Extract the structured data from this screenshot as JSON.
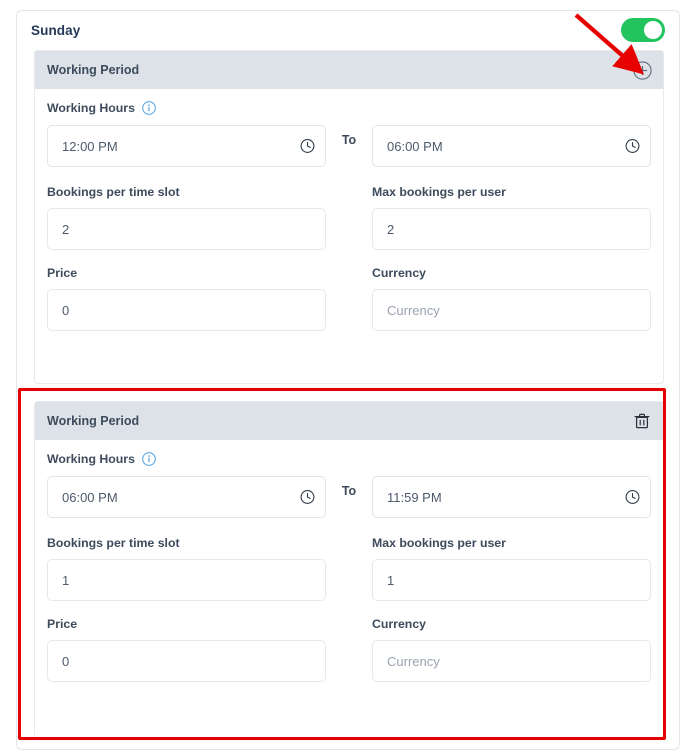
{
  "day": {
    "title": "Sunday",
    "toggle": {
      "name": "day-enabled-toggle",
      "state": "on",
      "color": "#21c45d"
    }
  },
  "labels": {
    "working_period": "Working Period",
    "working_hours": "Working Hours",
    "to": "To",
    "bookings_per_time_slot": "Bookings per time slot",
    "max_bookings_per_user": "Max bookings per user",
    "price": "Price",
    "currency": "Currency"
  },
  "icons": {
    "add": "plus-circle-icon",
    "delete": "trash-icon",
    "info": "info-icon",
    "clock": "clock-icon"
  },
  "placeholders": {
    "currency": "Currency"
  },
  "working_periods": [
    {
      "title": "Working Period",
      "action": "add",
      "start_time": "12:00 PM",
      "end_time": "06:00 PM",
      "bookings_per_time_slot": "2",
      "max_bookings_per_user": "2",
      "price": "0",
      "currency": "",
      "currency_placeholder": "Currency"
    },
    {
      "title": "Working Period",
      "action": "delete",
      "start_time": "06:00 PM",
      "end_time": "11:59 PM",
      "bookings_per_time_slot": "1",
      "max_bookings_per_user": "1",
      "price": "0",
      "currency": "",
      "currency_placeholder": "Currency"
    }
  ],
  "annotations": {
    "highlight_box_color": "#e60000",
    "arrow_color": "#e60000",
    "arrow_target": "plus-circle-icon"
  }
}
